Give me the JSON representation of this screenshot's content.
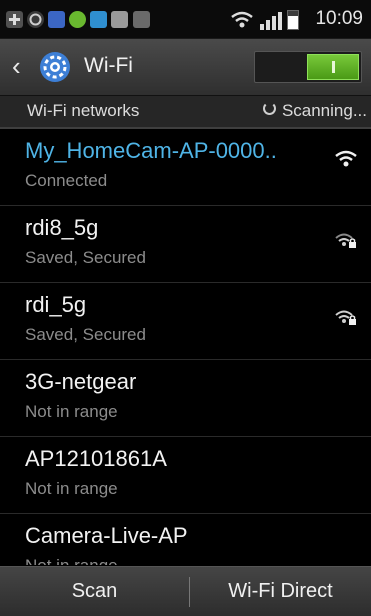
{
  "status_bar": {
    "time": "10:09",
    "icons": [
      "add-icon",
      "sync-icon",
      "messenger-icon",
      "android-icon",
      "usb-icon",
      "export-icon",
      "sim-icon"
    ]
  },
  "action_bar": {
    "title": "Wi-Fi",
    "wifi_enabled": true
  },
  "section": {
    "title": "Wi-Fi networks",
    "scanning_label": "Scanning..."
  },
  "networks": [
    {
      "name": "My_HomeCam-AP-0000..",
      "status": "Connected",
      "secured": false,
      "connected": true
    },
    {
      "name": "rdi8_5g",
      "status": "Saved, Secured",
      "secured": true,
      "connected": false
    },
    {
      "name": "rdi_5g",
      "status": "Saved, Secured",
      "secured": true,
      "connected": false
    },
    {
      "name": "3G-netgear",
      "status": "Not in range",
      "secured": false,
      "connected": false
    },
    {
      "name": "AP12101861A",
      "status": "Not in range",
      "secured": false,
      "connected": false
    },
    {
      "name": "Camera-Live-AP",
      "status": "Not in range",
      "secured": false,
      "connected": false
    }
  ],
  "bottom_bar": {
    "scan_label": "Scan",
    "wifi_direct_label": "Wi-Fi Direct"
  },
  "colors": {
    "connected": "#4fb4e6",
    "toggle_on": "#5bb01e"
  }
}
